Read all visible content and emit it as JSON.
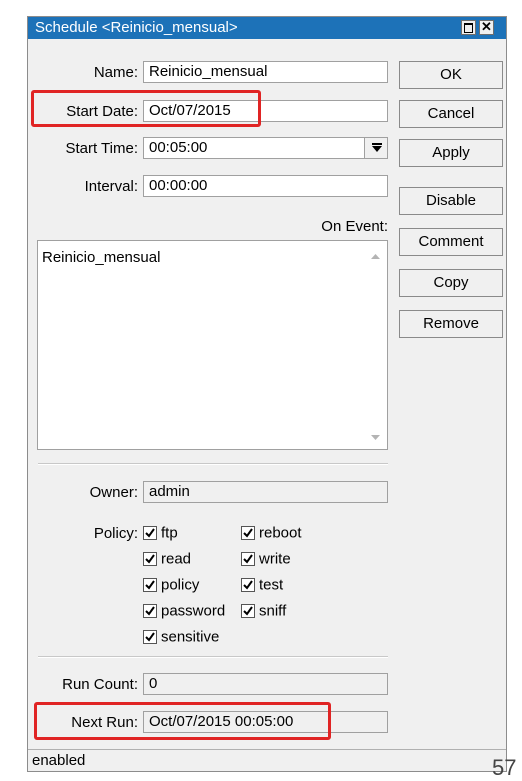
{
  "window": {
    "title": "Schedule <Reinicio_mensual>"
  },
  "form": {
    "name_label": "Name:",
    "name_value": "Reinicio_mensual",
    "start_date_label": "Start Date:",
    "start_date_value": "Oct/07/2015",
    "start_time_label": "Start Time:",
    "start_time_value": "00:05:00",
    "interval_label": "Interval:",
    "interval_value": "00:00:00",
    "on_event_label": "On Event:",
    "on_event_value": "Reinicio_mensual",
    "owner_label": "Owner:",
    "owner_value": "admin",
    "policy_label": "Policy:",
    "run_count_label": "Run Count:",
    "run_count_value": "0",
    "next_run_label": "Next Run:",
    "next_run_value": "Oct/07/2015 00:05:00"
  },
  "policies": [
    {
      "label": "ftp",
      "checked": true
    },
    {
      "label": "reboot",
      "checked": true
    },
    {
      "label": "read",
      "checked": true
    },
    {
      "label": "write",
      "checked": true
    },
    {
      "label": "policy",
      "checked": true
    },
    {
      "label": "test",
      "checked": true
    },
    {
      "label": "password",
      "checked": true
    },
    {
      "label": "sniff",
      "checked": true
    },
    {
      "label": "sensitive",
      "checked": true
    }
  ],
  "buttons": {
    "ok": "OK",
    "cancel": "Cancel",
    "apply": "Apply",
    "disable": "Disable",
    "comment": "Comment",
    "copy": "Copy",
    "remove": "Remove"
  },
  "status": {
    "text": "enabled"
  },
  "page_number": "57",
  "colors": {
    "titlebar": "#1d72b8",
    "highlight": "#e02424",
    "window_bg": "#f0f0f0"
  }
}
